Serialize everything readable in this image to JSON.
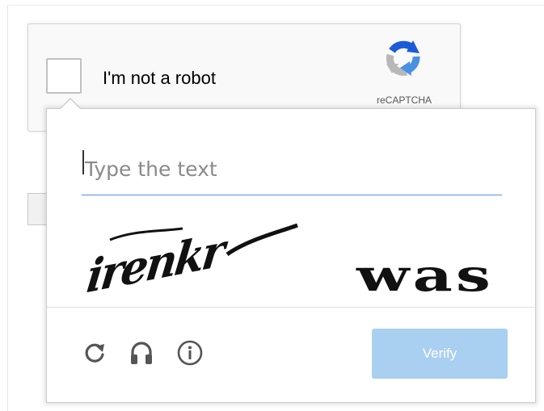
{
  "anchor": {
    "label": "I'm not a robot",
    "logo_text": "reCAPTCHA",
    "checked": false
  },
  "challenge": {
    "input_placeholder": "Type the text",
    "input_value": "",
    "captcha_words": [
      "irenkr",
      "was"
    ]
  },
  "footer": {
    "icons": [
      "reload-icon",
      "audio-headphones-icon",
      "info-icon"
    ],
    "verify_label": "Verify"
  },
  "colors": {
    "input_underline": "#4a90e2",
    "verify_button": "#a9cff1",
    "verify_text": "#ffffff",
    "logo_blue": "#1c5bd8",
    "logo_light_blue": "#4a90e2",
    "logo_gray": "#b8b8b8"
  }
}
